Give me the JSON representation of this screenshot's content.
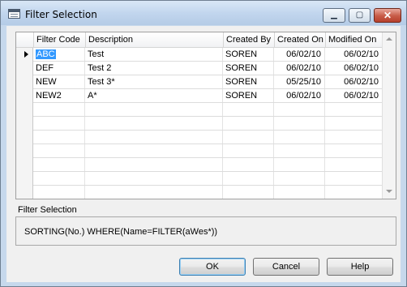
{
  "window": {
    "title": "Filter Selection"
  },
  "titlebar_buttons": {
    "minimize": "▁",
    "maximize": "▢",
    "close": "✕"
  },
  "table": {
    "columns": [
      "Filter Code",
      "Description",
      "Created By",
      "Created On",
      "Modified On"
    ],
    "rows": [
      {
        "code": "ABC",
        "description": "Test",
        "created_by": "SOREN",
        "created_on": "06/02/10",
        "modified_on": "06/02/10"
      },
      {
        "code": "DEF",
        "description": "Test 2",
        "created_by": "SOREN",
        "created_on": "06/02/10",
        "modified_on": "06/02/10"
      },
      {
        "code": "NEW",
        "description": "Test 3*",
        "created_by": "SOREN",
        "created_on": "05/25/10",
        "modified_on": "06/02/10"
      },
      {
        "code": "NEW2",
        "description": "A*",
        "created_by": "SOREN",
        "created_on": "06/02/10",
        "modified_on": "06/02/10"
      }
    ]
  },
  "filter_selection": {
    "label": "Filter Selection",
    "value": "SORTING(No.) WHERE(Name=FILTER(aWes*))"
  },
  "buttons": {
    "ok": "OK",
    "cancel": "Cancel",
    "help": "Help"
  }
}
